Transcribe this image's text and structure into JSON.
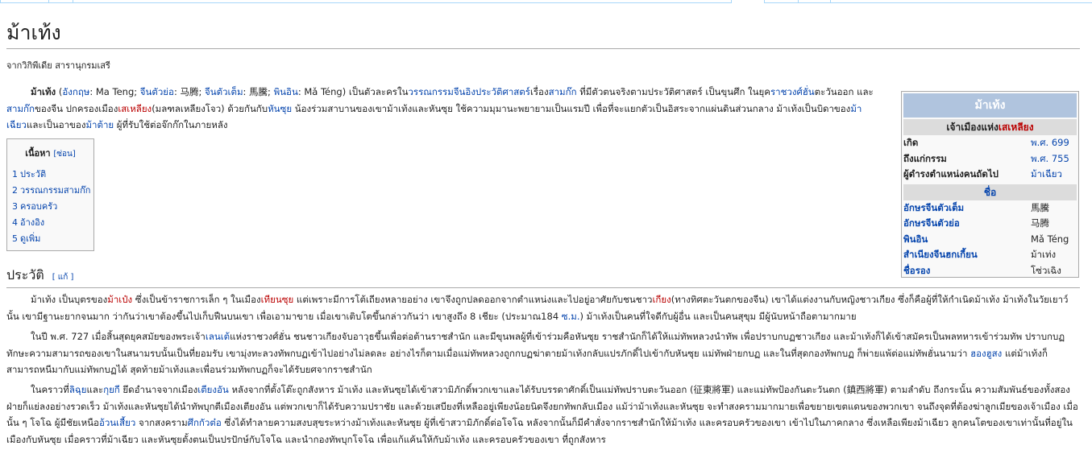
{
  "title": "ม้าเท้ง",
  "site_sub": "จากวิกิพีเดีย สารานุกรมเสรี",
  "intro": [
    {
      "t": "ม้าเท้ง",
      "b": true
    },
    {
      "t": " ("
    },
    {
      "t": "อังกฤษ",
      "l": true
    },
    {
      "t": ": Ma Teng; "
    },
    {
      "t": "จีนตัวย่อ",
      "l": true
    },
    {
      "t": ": 马腾; "
    },
    {
      "t": "จีนตัวเต็ม",
      "l": true
    },
    {
      "t": ": 馬騰; "
    },
    {
      "t": "พินอิน",
      "l": true
    },
    {
      "t": ": Mǎ Téng) เป็นตัวละครใน"
    },
    {
      "t": "วรรณกรรมจีนอิงประวัติศาสตร์",
      "l": true
    },
    {
      "t": "เรื่อง"
    },
    {
      "t": "สามก๊ก",
      "l": true
    },
    {
      "t": " ที่มีตัวตนจริงตามประวัติศาสตร์ เป็นขุนศึก ในยุค"
    },
    {
      "t": "ราชวงศ์ฮั่น",
      "l": true
    },
    {
      "t": "ตะวันออก และ"
    },
    {
      "t": "สามก๊ก",
      "l": true
    },
    {
      "t": "ของจีน ปกครองเมือง"
    },
    {
      "t": "เสเหลียง",
      "r": true
    },
    {
      "t": "(มลฑลเหลียงโจว) ด้วยกันกับ"
    },
    {
      "t": "หันซุย",
      "l": true
    },
    {
      "t": " น้องร่วมสาบานของเขาม้าเท้งและหันซุย ใช้ความมุมานะพยายามเป็นแรมปี เพื่อที่จะแยกตัวเป็นอิสระจากแผ่นดินส่วนกลาง ม้าเท้งเป็นบิดาของ"
    },
    {
      "t": "ม้าเฉียว",
      "l": true
    },
    {
      "t": "และเป็นอาของ"
    },
    {
      "t": "ม้าต้าย",
      "l": true
    },
    {
      "t": " ผู้ที่รับใช้ต่อจ๊กก๊กในภายหลัง"
    }
  ],
  "toc": {
    "title": "เนื้อหา",
    "hide": "[ซ่อน]",
    "items": [
      {
        "num": "1",
        "label": "ประวัติ"
      },
      {
        "num": "2",
        "label": "วรรณกรรมสามก๊ก"
      },
      {
        "num": "3",
        "label": "ครอบครัว"
      },
      {
        "num": "4",
        "label": "อ้างอิง"
      },
      {
        "num": "5",
        "label": "ดูเพิ่ม"
      }
    ]
  },
  "infobox": {
    "title": "ม้าเท้ง",
    "subtitle_prefix": "เจ้าเมืองแห่ง",
    "subtitle_link": "เสเหลียง",
    "rows": [
      {
        "k": "เกิด",
        "v": "พ.ศ. 699",
        "vlink": true
      },
      {
        "k": "ถึงแก่กรรม",
        "v": "พ.ศ. 755",
        "vlink": true
      },
      {
        "k": "ผู้ดำรงตำแหน่งคนถัดไป",
        "v": "ม้าเฉียว",
        "vlink": true
      }
    ],
    "name_header": "ชื่อ",
    "name_rows": [
      {
        "k": "อักษรจีนตัวเต็ม",
        "v": "馬騰"
      },
      {
        "k": "อักษรจีนตัวย่อ",
        "v": "马腾"
      },
      {
        "k": "พินอิน",
        "v": "Mǎ Téng"
      },
      {
        "k": "สำเนียงจีนฮกเกี้ยน",
        "v": "ม้าเท่ง"
      },
      {
        "k": "ชื่อรอง",
        "v": "โซ่วเฉิง"
      }
    ]
  },
  "section_heading": "ประวัติ",
  "section_edit": "[ แก้ ]",
  "body": [
    [
      {
        "t": "ม้าเท้ง เป็นบุตรของ"
      },
      {
        "t": "ม้าเป๋ง",
        "r": true
      },
      {
        "t": " ซึ่งเป็นข้าราชการเล็ก ๆ ในเมือง"
      },
      {
        "t": "เทียนซุย",
        "r": true
      },
      {
        "t": " แต่เพราะมีการโต้เถียงหลายอย่าง เขาจึงถูกปลดออกจากตำแหน่งและไปอยู่อาศัยกับชนชาว"
      },
      {
        "t": "เกียง",
        "r": true
      },
      {
        "t": "(ทางทิศตะวันตกของจีน) เขาได้แต่งงานกับหญิงชาวเกียง ซึ่งก็คือผู้ที่ให้กำเนิดม้าเท้ง ม้าเท้งในวัยเยาว์นั้น เขามีฐานะยากจนมาก ว่ากันว่าเขาต้องขึ้นไปเก็บฟืนบนเขา เพื่อเอามาขาย เมื่อเขาเติบโตขึ้นกล่าวกันว่า เขาสูงถึง 8 เชียะ (ประมาณ184 "
      },
      {
        "t": "ซ.ม.",
        "l": true
      },
      {
        "t": ") ม้าเท้งเป็นคนที่ใจดีกับผู้อื่น และเป็นคนสุขุม มีผู้นับหน้าถือตามากมาย"
      }
    ],
    [
      {
        "t": "ในปี พ.ศ. 727 เมื่อสิ้นสุดยุคสมัยของพระเจ้า"
      },
      {
        "t": "เลนเต้",
        "l": true
      },
      {
        "t": "แห่งราชวงศ์ฮั่น ชนชาวเกียงจับอาวุธขึ้นเพื่อต่อต้านราชสำนัก และมีขุนพลผู้ที่เข้าร่วมคือหันซุย ราชสำนักก็ได้ให้แม่ทัพหลวงนำทัพ เพื่อปราบกบฏชาวเกียง และม้าเท้งก็ได้เข้าสมัครเป็นพลทหารเข้าร่วมทัพ ปราบกบฏ ทักษะความสามารถของเขาในสนามรบนั้นเป็นที่ยอมรับ เขามุ่งทะลวงทัพกบฏเข้าไปอย่างไม่ลดละ อย่างไรก็ตามเมื่อแม่ทัพหลวงถูกกบฏฆ่าตายม้าเท้งกลับแปรภักดิ์ไปเข้ากับหันซุย แม่ทัพฝ่ายกบฏ และในที่สุดกองทัพกบฏ ก็พ่ายแพ้ต่อแม่ทัพฮั่นนามว่า "
      },
      {
        "t": "ฮองฮูสง",
        "l": true
      },
      {
        "t": " แต่ม้าเท้งก็สามารถหนีมากับแม่ทัพกบฏได้ สุดท้ายม้าเท้งและเพื่อนร่วมทัพกบฏก็จะได้รับยศจากราชสำนัก"
      }
    ],
    [
      {
        "t": "ในคราวที่"
      },
      {
        "t": "ลิฉุย",
        "l": true
      },
      {
        "t": "และ"
      },
      {
        "t": "กุยกี",
        "l": true
      },
      {
        "t": " ยึดอำนาจจากเมือง"
      },
      {
        "t": "เตียงอัน",
        "l": true
      },
      {
        "t": " หลังจากที่ตั้งโต๊ะถูกสังหาร ม้าเท้ง และหันซุยได้เข้าสวามิภักดิ์พวกเขาและได้รับบรรดาศักดิ์เป็นแม่ทัพปราบตะวันออก (征東將軍) และแม่ทัพป้องกันตะวันตก (鎮西將軍) ตามลำดับ ถึงกระนั้น ความสัมพันธ์ของทั้งสองฝ่ายก็แย่ลงอย่างรวดเร็ว ม้าเท้งและหันซุยได้นำทัพบุกตีเมืองเตียงอัน แต่พวกเขาก็ได้รับความปราชัย และด้วยเสบียงที่เหลืออยู่เพียงน้อยนิดจึงยกทัพกลับเมือง แม้ว่าม้าเท้งและหันซุย จะทำสงครามมากมายเพื่อขยายเขตแดนของพวกเขา จนถึงจุดที่ต้องฆ่าลูกเมียของเจ้าเมือง เมื่อนั้น ๆ โจโฉ ผู้มีชัยเหนือ"
      },
      {
        "t": "อ้วนเสี้ยว",
        "l": true
      },
      {
        "t": " จากสงคราม"
      },
      {
        "t": "ศึกกัวต๋อ",
        "l": true
      },
      {
        "t": " ซึ่งได้ทำลายความสงบสุขระหว่างม้าเท้งและหันซุย ผู้ที่เข้าสวามิภักดิ์ต่อโจโฉ หลังจากนั้นก็มีคำสั่งจากราชสำนักให้ม้าเท้ง และครอบครัวของเขา เข้าไปในภาคกลาง ซึ่งเหลือเพียงม้าเฉียว ลูกคนโตของเขาเท่านั้นที่อยู่ในเมืองกับหันซุย เมื่อคราวที่ม้าเฉียว และหันซุยตั้งตนเป็นปรปักษ์กับโจโฉ และนำกองทัพบุกโจโฉ เพื่อแก้แค้นให้กับม้าเท้ง และครอบครัวของเขา ที่ถูกสังหาร"
      }
    ]
  ]
}
